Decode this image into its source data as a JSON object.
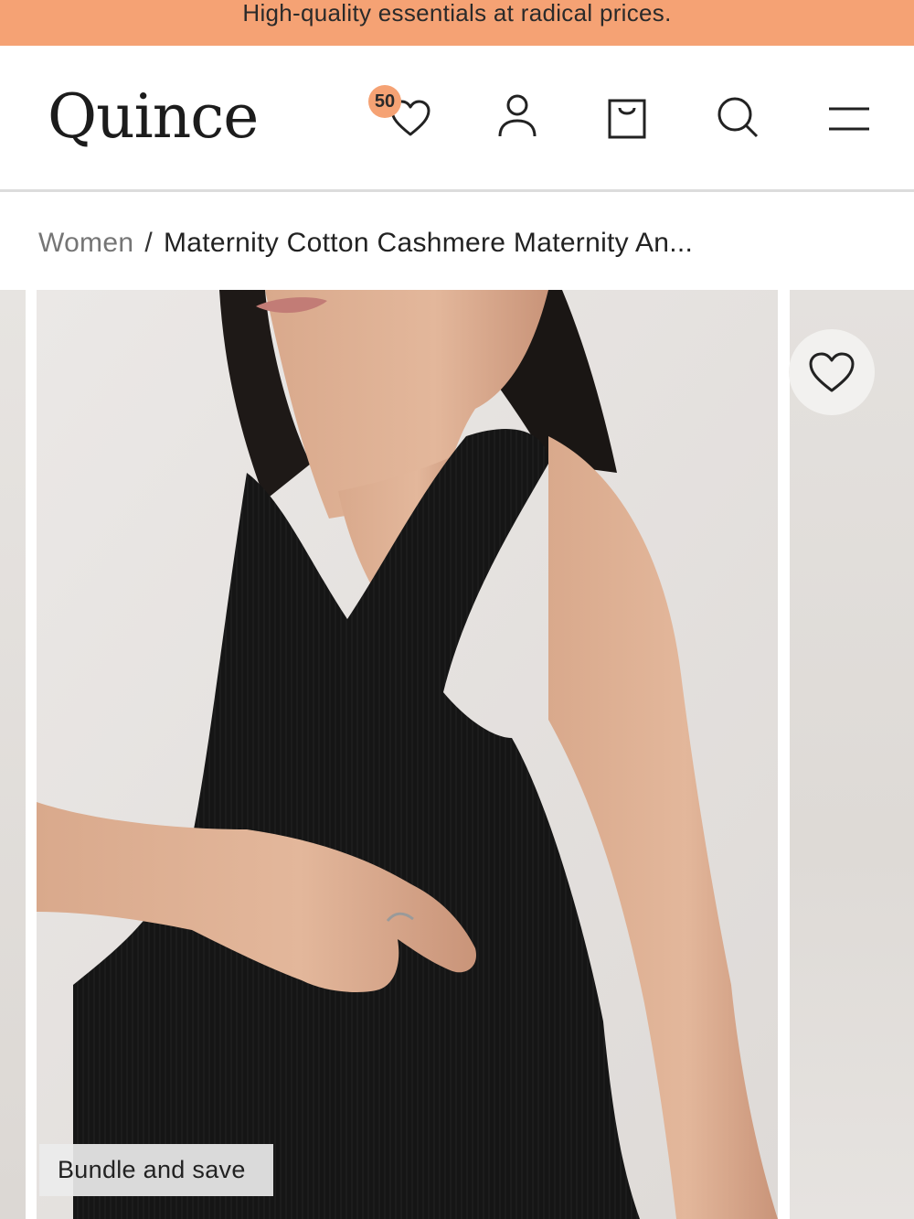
{
  "promo_banner": {
    "text": "High-quality essentials at radical prices."
  },
  "header": {
    "logo": "Quince",
    "wishlist_count": "50",
    "icons": [
      "heart-icon",
      "user-icon",
      "shopping-bag-icon",
      "search-icon",
      "menu-icon"
    ]
  },
  "breadcrumb": {
    "parent": "Women",
    "separator": "/",
    "current": "Maternity Cotton Cashmere Maternity An..."
  },
  "gallery": {
    "badge": "Bundle and save"
  },
  "colors": {
    "accent": "#f5a274",
    "text": "#1f1f1f",
    "muted": "#757575",
    "divider": "#dcdcdc"
  }
}
